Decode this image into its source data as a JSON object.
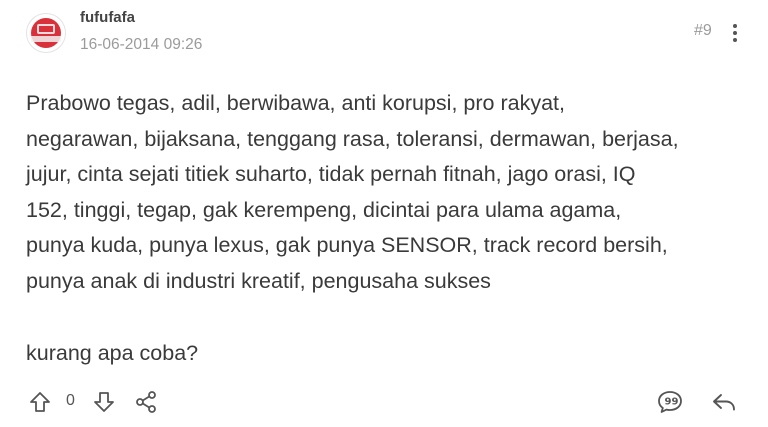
{
  "post": {
    "username": "fufufafa",
    "timestamp": "16-06-2014 09:26",
    "number": "#9",
    "body_lines": [
      "Prabowo tegas, adil, berwibawa, anti korupsi, pro rakyat,",
      "negarawan, bijaksana, tenggang rasa, toleransi, dermawan, berjasa,",
      "jujur, cinta sejati titiek suharto, tidak pernah fitnah, jago orasi, IQ",
      "152, tinggi, tegap, gak kerempeng, dicintai para ulama agama,",
      "punya kuda, punya lexus, gak punya SENSOR, track record bersih,",
      "punya anak di industri kreatif, pengusaha sukses"
    ],
    "closing": "kurang apa coba?",
    "vote_count": "0"
  },
  "icons": {
    "avatar": "avatar",
    "more": "more-vertical-icon",
    "upvote": "arrow-up-icon",
    "downvote": "arrow-down-icon",
    "share": "share-icon",
    "quote": "quote-icon",
    "reply": "reply-icon"
  },
  "colors": {
    "avatar_red": "#d9313a",
    "text": "#3a3a3a",
    "muted": "#9b9b9b"
  }
}
